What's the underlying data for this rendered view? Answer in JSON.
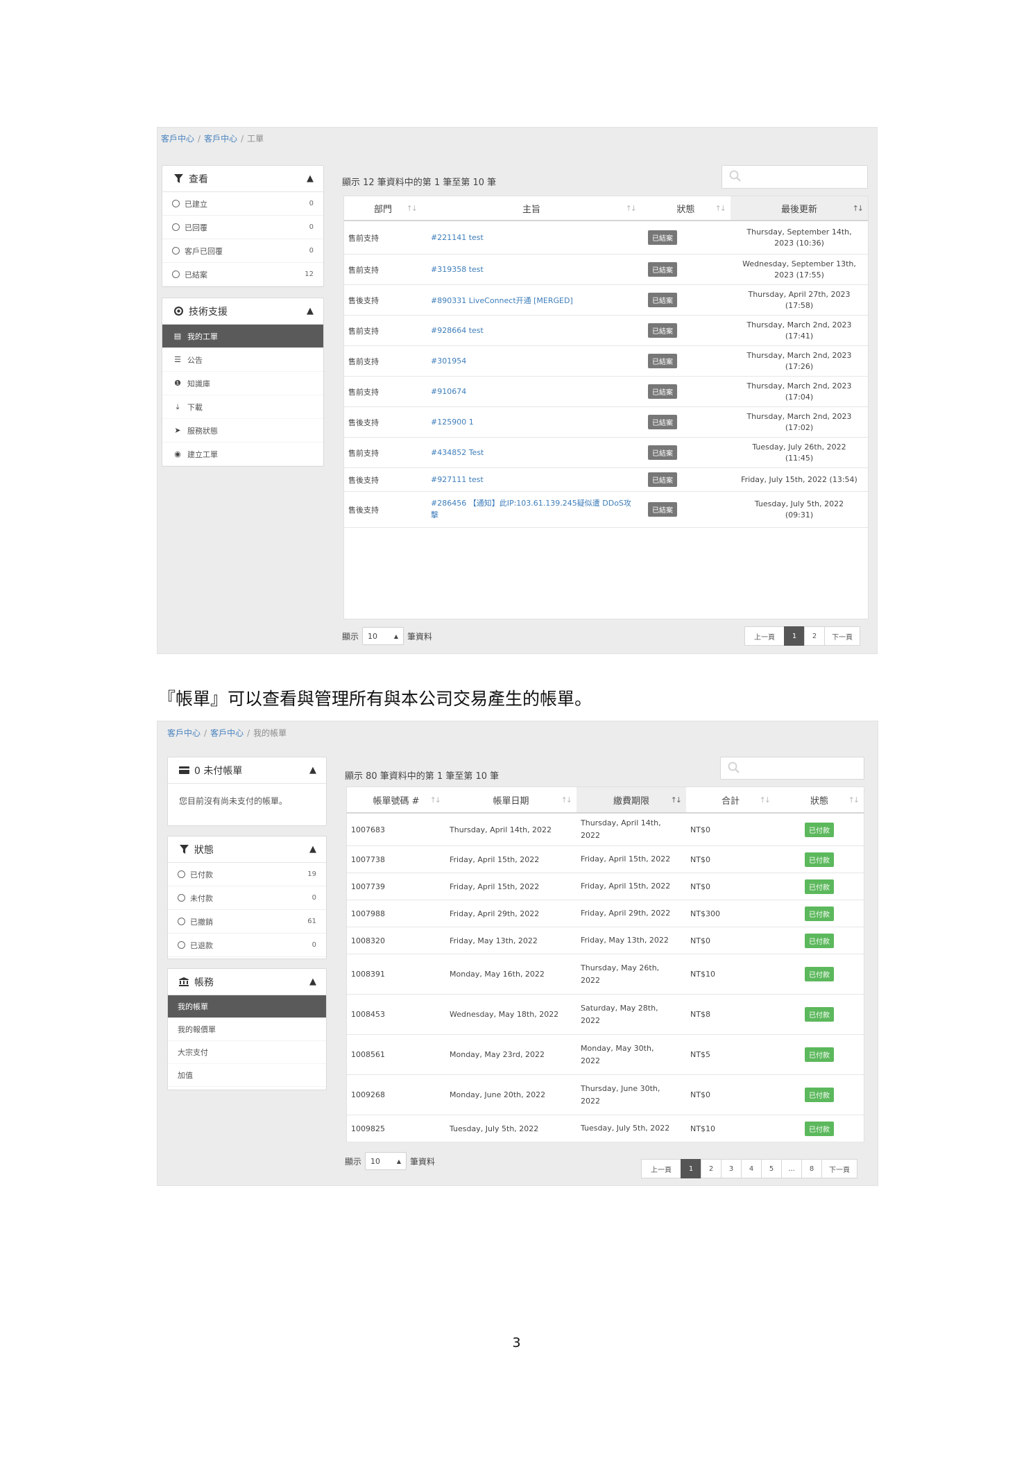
{
  "tickets": {
    "breadcrumb": [
      "客戶中心",
      "客戶中心",
      "工單"
    ],
    "filter_panel": {
      "title": "查看",
      "items": [
        {
          "label": "已建立",
          "count": "0"
        },
        {
          "label": "已回覆",
          "count": "0"
        },
        {
          "label": "客戶已回覆",
          "count": "0"
        },
        {
          "label": "已結案",
          "count": "12"
        }
      ]
    },
    "support_panel": {
      "title": "技術支援",
      "items": [
        {
          "label": "我的工單"
        },
        {
          "label": "公告"
        },
        {
          "label": "知識庫"
        },
        {
          "label": "下載"
        },
        {
          "label": "服務狀態"
        },
        {
          "label": "建立工單"
        }
      ]
    },
    "summary": "顯示 12 筆資料中的第 1 筆至第 10 筆",
    "columns": [
      "部門",
      "主旨",
      "狀態",
      "最後更新"
    ],
    "rows": [
      {
        "dept": "售前支持",
        "subject": "#221141 test",
        "status": "已結案",
        "updated": [
          "Thursday, September 14th,",
          "2023 (10:36)"
        ]
      },
      {
        "dept": "售前支持",
        "subject": "#319358 test",
        "status": "已結案",
        "updated": [
          "Wednesday, September 13th,",
          "2023 (17:55)"
        ]
      },
      {
        "dept": "售後支持",
        "subject": "#890331 LiveConnect开通 [MERGED]",
        "status": "已結案",
        "updated": [
          "Thursday, April 27th, 2023",
          "(17:58)"
        ]
      },
      {
        "dept": "售前支持",
        "subject": "#928664 test",
        "status": "已結案",
        "updated": [
          "Thursday, March 2nd, 2023",
          "(17:41)"
        ]
      },
      {
        "dept": "售前支持",
        "subject": "#301954",
        "status": "已結案",
        "updated": [
          "Thursday, March 2nd, 2023",
          "(17:26)"
        ]
      },
      {
        "dept": "售前支持",
        "subject": "#910674",
        "status": "已結案",
        "updated": [
          "Thursday, March 2nd, 2023",
          "(17:04)"
        ]
      },
      {
        "dept": "售後支持",
        "subject": "#125900 1",
        "status": "已結案",
        "updated": [
          "Thursday, March 2nd, 2023",
          "(17:02)"
        ]
      },
      {
        "dept": "售前支持",
        "subject": "#434852 Test",
        "status": "已結案",
        "updated": [
          "Tuesday, July 26th, 2022",
          "(11:45)"
        ]
      },
      {
        "dept": "售後支持",
        "subject": "#927111 test",
        "status": "已結案",
        "updated": [
          "Friday, July 15th, 2022 (13:54)"
        ]
      },
      {
        "dept": "售後支持",
        "subject": "#286456 【通知】此IP:103.61.139.245疑似遭 DDoS攻擊",
        "status": "已結案",
        "updated": [
          "Tuesday, July 5th, 2022",
          "(09:31)"
        ]
      }
    ],
    "length": {
      "prefix": "顯示",
      "value": "10",
      "suffix": "筆資料"
    },
    "pager": [
      "上一頁",
      "1",
      "2",
      "下一頁"
    ]
  },
  "caption": "『帳單』可以查看與管理所有與本公司交易產生的帳單。",
  "invoices": {
    "breadcrumb": [
      "客戶中心",
      "客戶中心",
      "我的帳單"
    ],
    "unpaid_panel": {
      "title": "0 未付帳單",
      "message": "您目前沒有尚未支付的帳單。"
    },
    "status_panel": {
      "title": "狀態",
      "items": [
        {
          "label": "已付款",
          "count": "19"
        },
        {
          "label": "未付款",
          "count": "0"
        },
        {
          "label": "已撤銷",
          "count": "61"
        },
        {
          "label": "已退款",
          "count": "0"
        }
      ]
    },
    "account_panel": {
      "title": "帳務",
      "items": [
        {
          "label": "我的帳單"
        },
        {
          "label": "我的報價單"
        },
        {
          "label": "大宗支付"
        },
        {
          "label": "加值"
        }
      ]
    },
    "summary": "顯示 80 筆資料中的第 1 筆至第 10 筆",
    "columns": [
      "帳單號碼 #",
      "帳單日期",
      "繳費期限",
      "合計",
      "狀態"
    ],
    "rows": [
      {
        "id": "1007683",
        "date": "Thursday, April 14th, 2022",
        "due": [
          "Thursday, April 14th,",
          "2022"
        ],
        "total": "NT$0",
        "status": "已付款"
      },
      {
        "id": "1007738",
        "date": "Friday, April 15th, 2022",
        "due": [
          "Friday, April 15th, 2022"
        ],
        "total": "NT$0",
        "status": "已付款"
      },
      {
        "id": "1007739",
        "date": "Friday, April 15th, 2022",
        "due": [
          "Friday, April 15th, 2022"
        ],
        "total": "NT$0",
        "status": "已付款"
      },
      {
        "id": "1007988",
        "date": "Friday, April 29th, 2022",
        "due": [
          "Friday, April 29th, 2022"
        ],
        "total": "NT$300",
        "status": "已付款"
      },
      {
        "id": "1008320",
        "date": "Friday, May 13th, 2022",
        "due": [
          "Friday, May 13th, 2022"
        ],
        "total": "NT$0",
        "status": "已付款"
      },
      {
        "id": "1008391",
        "date": "Monday, May 16th, 2022",
        "due": [
          "Thursday, May 26th,",
          "2022"
        ],
        "total": "NT$10",
        "status": "已付款"
      },
      {
        "id": "1008453",
        "date": "Wednesday, May 18th, 2022",
        "due": [
          "Saturday, May 28th,",
          "2022"
        ],
        "total": "NT$8",
        "status": "已付款"
      },
      {
        "id": "1008561",
        "date": "Monday, May 23rd, 2022",
        "due": [
          "Monday, May 30th,",
          "2022"
        ],
        "total": "NT$5",
        "status": "已付款"
      },
      {
        "id": "1009268",
        "date": "Monday, June 20th, 2022",
        "due": [
          "Thursday, June 30th,",
          "2022"
        ],
        "total": "NT$0",
        "status": "已付款"
      },
      {
        "id": "1009825",
        "date": "Tuesday, July 5th, 2022",
        "due": [
          "Tuesday, July 5th, 2022"
        ],
        "total": "NT$10",
        "status": "已付款"
      }
    ],
    "length": {
      "prefix": "顯示",
      "value": "10",
      "suffix": "筆資料"
    },
    "pager": [
      "上一頁",
      "1",
      "2",
      "3",
      "4",
      "5",
      "...",
      "8",
      "下一頁"
    ]
  },
  "page_number": "3"
}
